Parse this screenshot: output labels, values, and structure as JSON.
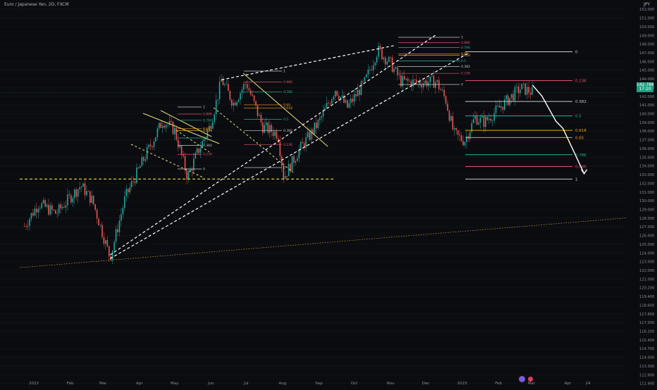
{
  "header": {
    "title": "Euro / Japanese Yen, 2D, FXCM",
    "currency": "JPY"
  },
  "last_price": {
    "value": "142.788",
    "sub": "17:20"
  },
  "colors": {
    "background": "#0b0c10",
    "up": "#26a69a",
    "down": "#ef5350",
    "trendline": "#ffffff",
    "channel": "#e6e27a",
    "support": "#e0c341",
    "fib_white": "#c8c8c8",
    "fib_red": "#e0506a",
    "fib_green": "#22b59a",
    "fib_orange": "#f0a020",
    "fib_grey": "#8c8c8c"
  },
  "chart_data": {
    "type": "candlestick",
    "title": "Euro / Japanese Yen, 2D, FXCM",
    "ylim": [
      111.6,
      152.4
    ],
    "y_ticks": [
      "152.000",
      "151.000",
      "150.000",
      "149.000",
      "148.000",
      "147.000",
      "146.000",
      "145.000",
      "144.000",
      "143.000",
      "142.000",
      "141.000",
      "140.000",
      "139.000",
      "138.000",
      "137.000",
      "136.000",
      "135.000",
      "134.000",
      "133.000",
      "132.000",
      "131.000",
      "130.000",
      "129.000",
      "128.000",
      "127.000",
      "126.000",
      "125.000",
      "124.000",
      "123.000",
      "122.000",
      "121.000",
      "120.200",
      "119.400",
      "118.600",
      "117.800",
      "117.000",
      "116.200",
      "115.400",
      "114.700",
      "114.000",
      "113.300",
      "112.600",
      "111.900"
    ],
    "x_ticks": [
      "2022",
      "Feb",
      "Mar",
      "Apr",
      "May",
      "Jun",
      "Jul",
      "Aug",
      "Sep",
      "Oct",
      "Nov",
      "Dec",
      "2023",
      "Feb",
      "Mar",
      "Apr",
      "24"
    ],
    "close_path": [
      [
        "2021-12-24",
        128.0
      ],
      [
        "2022-01-05",
        130.5
      ],
      [
        "2022-01-20",
        129.4
      ],
      [
        "2022-02-10",
        132.5
      ],
      [
        "2022-02-20",
        130.8
      ],
      [
        "2022-03-07",
        124.5
      ],
      [
        "2022-03-20",
        131.2
      ],
      [
        "2022-04-05",
        135.5
      ],
      [
        "2022-04-21",
        139.7
      ],
      [
        "2022-05-01",
        138.6
      ],
      [
        "2022-05-12",
        133.4
      ],
      [
        "2022-05-20",
        136.0
      ],
      [
        "2022-05-31",
        139.0
      ],
      [
        "2022-06-05",
        141.5
      ],
      [
        "2022-06-10",
        144.2
      ],
      [
        "2022-06-20",
        141.6
      ],
      [
        "2022-07-01",
        143.9
      ],
      [
        "2022-07-15",
        139.0
      ],
      [
        "2022-07-28",
        138.2
      ],
      [
        "2022-08-02",
        133.4
      ],
      [
        "2022-08-15",
        136.4
      ],
      [
        "2022-09-01",
        139.5
      ],
      [
        "2022-09-15",
        143.2
      ],
      [
        "2022-09-25",
        141.1
      ],
      [
        "2022-10-10",
        143.9
      ],
      [
        "2022-10-21",
        147.5
      ],
      [
        "2022-11-01",
        146.0
      ],
      [
        "2022-11-10",
        144.0
      ],
      [
        "2022-11-25",
        143.9
      ],
      [
        "2022-12-10",
        144.0
      ],
      [
        "2022-12-18",
        142.0
      ],
      [
        "2022-12-25",
        138.2
      ],
      [
        "2023-01-03",
        137.4
      ],
      [
        "2023-01-12",
        140.0
      ],
      [
        "2023-01-20",
        139.5
      ],
      [
        "2023-02-05",
        141.5
      ],
      [
        "2023-02-20",
        143.3
      ],
      [
        "2023-03-02",
        142.8
      ]
    ],
    "trendlines": [
      {
        "label": "rising channel top",
        "from": [
          "2022-03-07",
          124.8
        ],
        "to": [
          "2022-12-10",
          149.2
        ]
      },
      {
        "label": "rising channel top (2)",
        "from": [
          "2022-06-10",
          144.2
        ],
        "to": [
          "2022-11-05",
          148.0
        ]
      },
      {
        "label": "rising support",
        "from": [
          "2022-03-07",
          124.4
        ],
        "to": [
          "2023-01-07",
          147.2
        ]
      },
      {
        "label": "long-term support",
        "from": [
          "2021-12-20",
          123.4
        ],
        "to": [
          "2024-01-01",
          128.9
        ]
      },
      {
        "label": "horizontal support",
        "from": [
          "2021-12-20",
          133.2
        ],
        "to": [
          "2022-09-15",
          133.2
        ]
      }
    ],
    "fib_levels_projection": [
      {
        "label": "0",
        "price": 147.3
      },
      {
        "label": "0.236",
        "price": 144.1
      },
      {
        "label": "0.382",
        "price": 141.8
      },
      {
        "label": "0.5",
        "price": 140.2
      },
      {
        "label": "0.618",
        "price": 138.6
      },
      {
        "label": "0.65",
        "price": 137.8
      },
      {
        "label": "0.786",
        "price": 135.9
      },
      {
        "label": "0.886",
        "price": 134.6
      },
      {
        "label": "1",
        "price": 133.2
      }
    ],
    "fib_level_labels_small": [
      "1",
      "0.886",
      "0.786",
      "0.65",
      "0.618",
      "0.5",
      "0.382",
      "0.236",
      "0"
    ],
    "projection_path": [
      [
        "2023-03-02",
        143.6
      ],
      [
        "2023-03-10",
        142.4
      ],
      [
        "2023-03-22",
        139.6
      ],
      [
        "2023-03-28",
        138.8
      ],
      [
        "2023-04-15",
        133.8
      ]
    ]
  }
}
